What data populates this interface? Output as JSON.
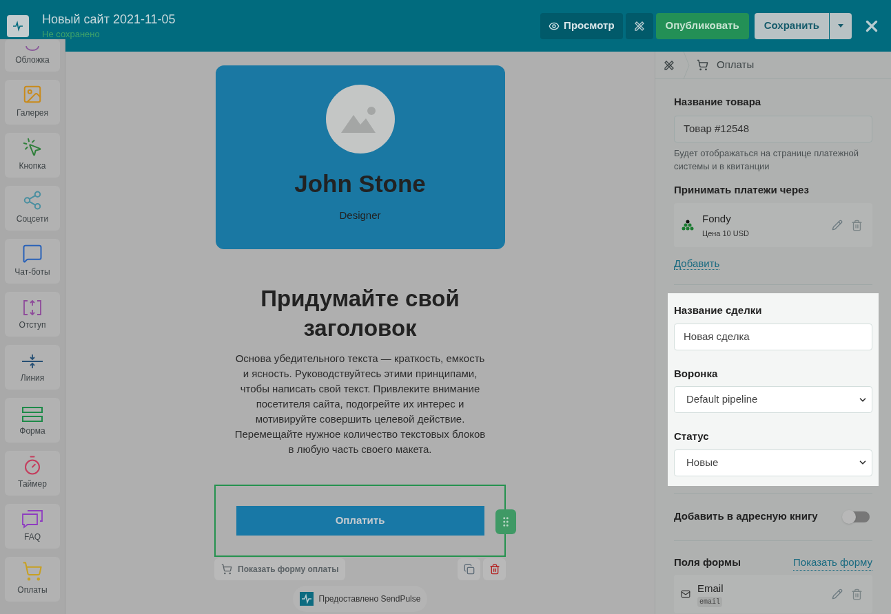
{
  "header": {
    "title": "Новый сайт 2021-11-05",
    "status": "Не сохранено",
    "buttons": [
      {
        "kind": "preview",
        "label": "Просмотр"
      },
      {
        "kind": "tools"
      },
      {
        "kind": "publish",
        "label": "Опубликовать"
      },
      {
        "kind": "save",
        "label": "Сохранить"
      },
      {
        "kind": "caret"
      },
      {
        "kind": "close"
      }
    ]
  },
  "sidebar": {
    "items": [
      {
        "kind": "cover",
        "label": "Обложка",
        "color": "#8a5a9a"
      },
      {
        "kind": "gallery",
        "label": "Галерея",
        "color": "#c98a1a"
      },
      {
        "kind": "button",
        "label": "Кнопка",
        "color": "#2f7f3a"
      },
      {
        "kind": "share",
        "label": "Соцсети",
        "color": "#4a8fa0"
      },
      {
        "kind": "chat",
        "label": "Чат-боты",
        "color": "#2a62b8"
      },
      {
        "kind": "indent",
        "label": "Отступ",
        "color": "#8e4a9a"
      },
      {
        "kind": "line",
        "label": "Линия",
        "color": "#264f74"
      },
      {
        "kind": "form",
        "label": "Форма",
        "color": "#1d8a48"
      },
      {
        "kind": "timer",
        "label": "Таймер",
        "color": "#c43c5c"
      },
      {
        "kind": "faq",
        "label": "FAQ",
        "color": "#8e3cc0"
      },
      {
        "kind": "cart",
        "label": "Оплаты",
        "color": "#c8a020"
      }
    ]
  },
  "canvas": {
    "profile": {
      "name": "John Stone",
      "role": "Designer"
    },
    "heading": "Придумайте свой заголовок",
    "body": "Основа убедительного текста — краткость, емкость и ясность. Руководствуйтесь этими принципами, чтобы написать свой текст. Привлеките внимание посетителя сайта, подогрейте их интерес и мотивируйте совершить целевой действие. Перемещайте нужное количество текстовых блоков в любую часть своего макета.",
    "pay_button": "Оплатить",
    "show_form": "Показать форму оплаты",
    "badge": "Предоставлено SendPulse"
  },
  "panel": {
    "breadcrumb": "Оплаты",
    "product_label": "Название товара",
    "product_value": "Товар #12548",
    "product_hint": "Будет отображаться на странице платежной системы и в квитанции",
    "payments_label": "Принимать платежи через",
    "payment": {
      "name": "Fondy",
      "price": "Цена 10 USD"
    },
    "add_link": "Добавить",
    "deal_label": "Название сделки",
    "deal_value": "Новая сделка",
    "pipeline_label": "Воронка",
    "pipeline_value": "Default pipeline",
    "status_label": "Статус",
    "status_value": "Новые",
    "address_book": {
      "label": "Добавить в адресную книгу",
      "on": false
    },
    "fields_label": "Поля формы",
    "show_form_link": "Показать форму",
    "field": {
      "name": "Email",
      "tag": "email"
    }
  }
}
